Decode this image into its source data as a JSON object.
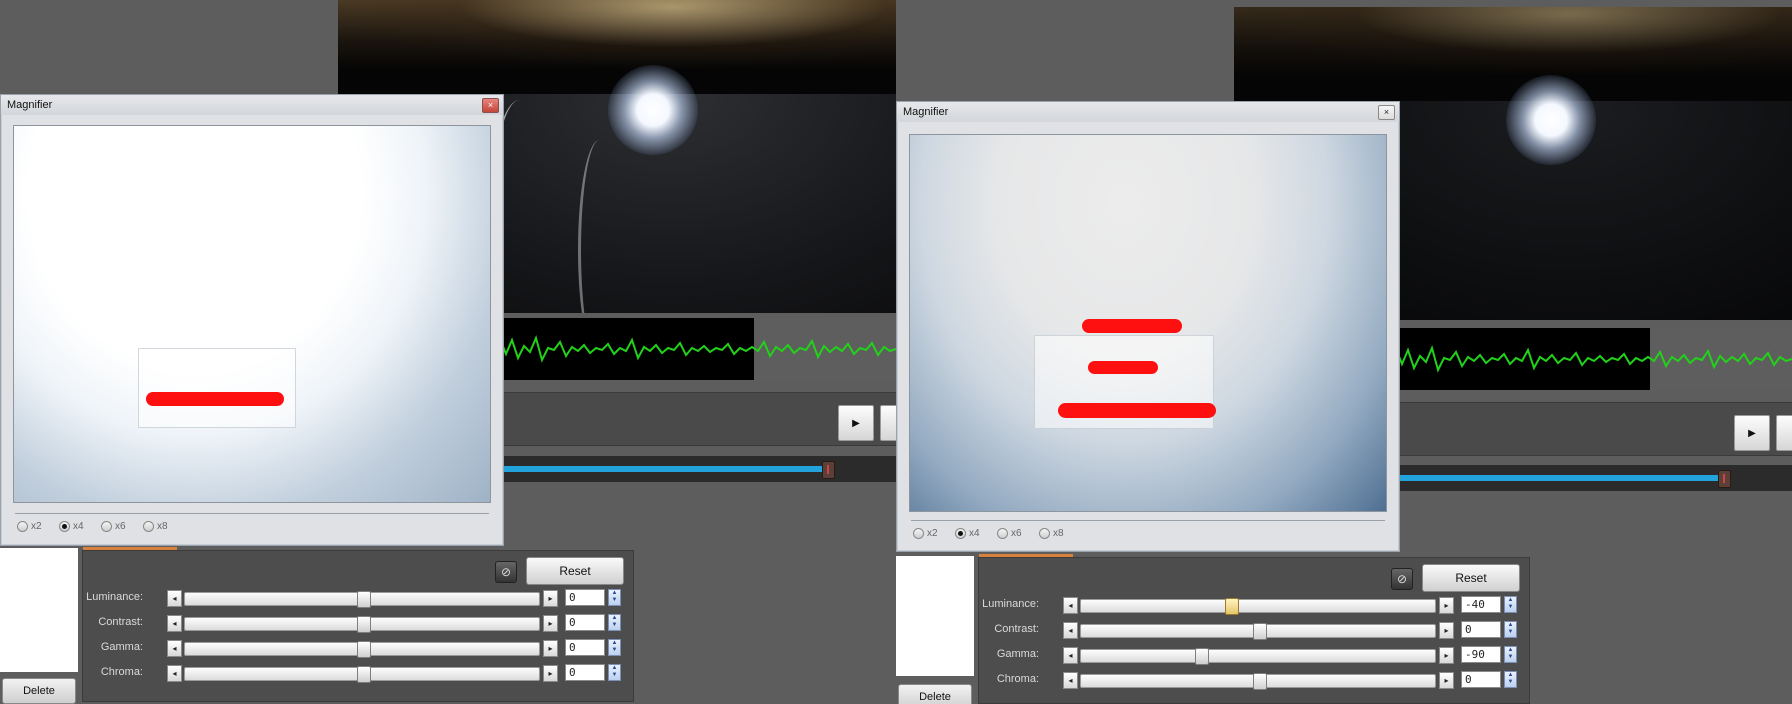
{
  "magnifier": {
    "title": "Magnifier",
    "close_glyph": "×",
    "zoom_options": [
      "x2",
      "x4",
      "x6",
      "x8"
    ],
    "selected_zoom": "x4"
  },
  "transport": {
    "play_glyph": "▶"
  },
  "actions": {
    "delete_label": "Delete",
    "reset_label": "Reset"
  },
  "adjust_left": {
    "rows": [
      {
        "label": "Luminance:",
        "value": "0",
        "level": 0.5
      },
      {
        "label": "Contrast:",
        "value": "0",
        "level": 0.5
      },
      {
        "label": "Gamma:",
        "value": "0",
        "level": 0.5
      },
      {
        "label": "Chroma:",
        "value": "0",
        "level": 0.5
      }
    ]
  },
  "adjust_right": {
    "rows": [
      {
        "label": "Luminance:",
        "value": "-40",
        "level": 0.4
      },
      {
        "label": "Contrast:",
        "value": "0",
        "level": 0.5
      },
      {
        "label": "Gamma:",
        "value": "-90",
        "level": 0.33
      },
      {
        "label": "Chroma:",
        "value": "0",
        "level": 0.5
      }
    ]
  },
  "icons": {
    "arrow_left": "◂",
    "arrow_right": "▸",
    "spin_up": "▲",
    "spin_down": "▼",
    "clip": "⊘"
  },
  "colors": {
    "seek_fill": "#23a3dc",
    "waveform": "#22d11a",
    "annotation": "#ff1010",
    "tab_accent": "#d7813d"
  }
}
